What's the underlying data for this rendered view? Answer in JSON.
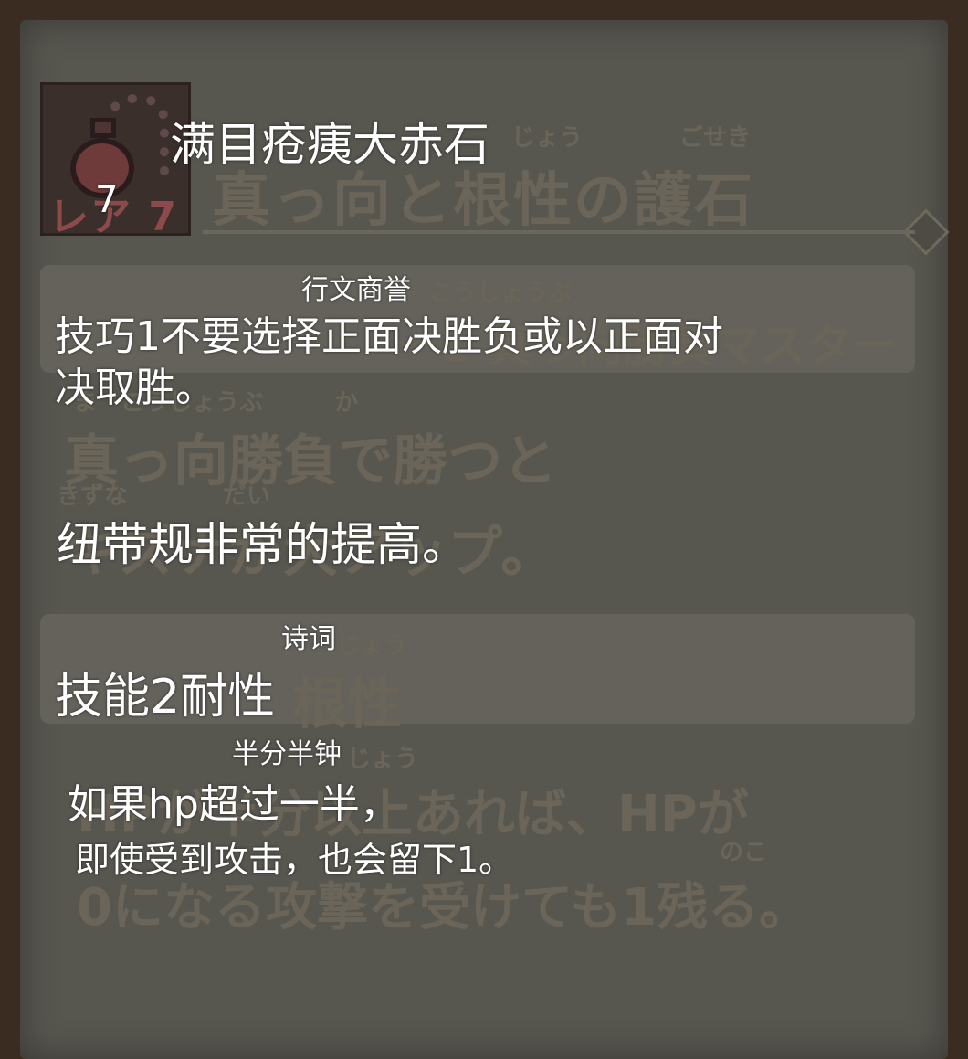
{
  "item": {
    "name": "满目疮痍大赤石",
    "level": "7"
  },
  "skill1": {
    "ruby": "行文商誉",
    "line1": "技巧1不要选择正面决胜负或以正面对",
    "line2": "决取胜。",
    "description": "纽带规非常的提高。"
  },
  "skill2": {
    "ruby": "诗词",
    "name": "技能2耐性",
    "ruby2": "半分半钟",
    "line1": "如果hp超过一半，",
    "line2": "即使受到攻击，也会留下1。"
  },
  "background": {
    "level": "レア 7",
    "title": "真っ向と根性の護石",
    "title_ruby_a": "じょう",
    "title_ruby_b": "ごせき",
    "skill1_ruby": "こうしょうぶ",
    "skill1_name": "ー1 真っ向勝負マスター",
    "desc_ruby_a": "ま　こうしょうぶ　　　か",
    "desc_line1": "真っ向勝負で勝つと",
    "desc_ruby_b": "きずな　　　　だい",
    "desc_line2": "キズナが大アップ。",
    "skill2_ruby": "じょう",
    "skill2_name": "根性",
    "hp_ruby": "じょう",
    "hp_line1": "HPが半分以上あれば、HPが",
    "hp_ruby2": "のこ",
    "hp_line2": "0になる攻撃を受けても1残る。"
  }
}
